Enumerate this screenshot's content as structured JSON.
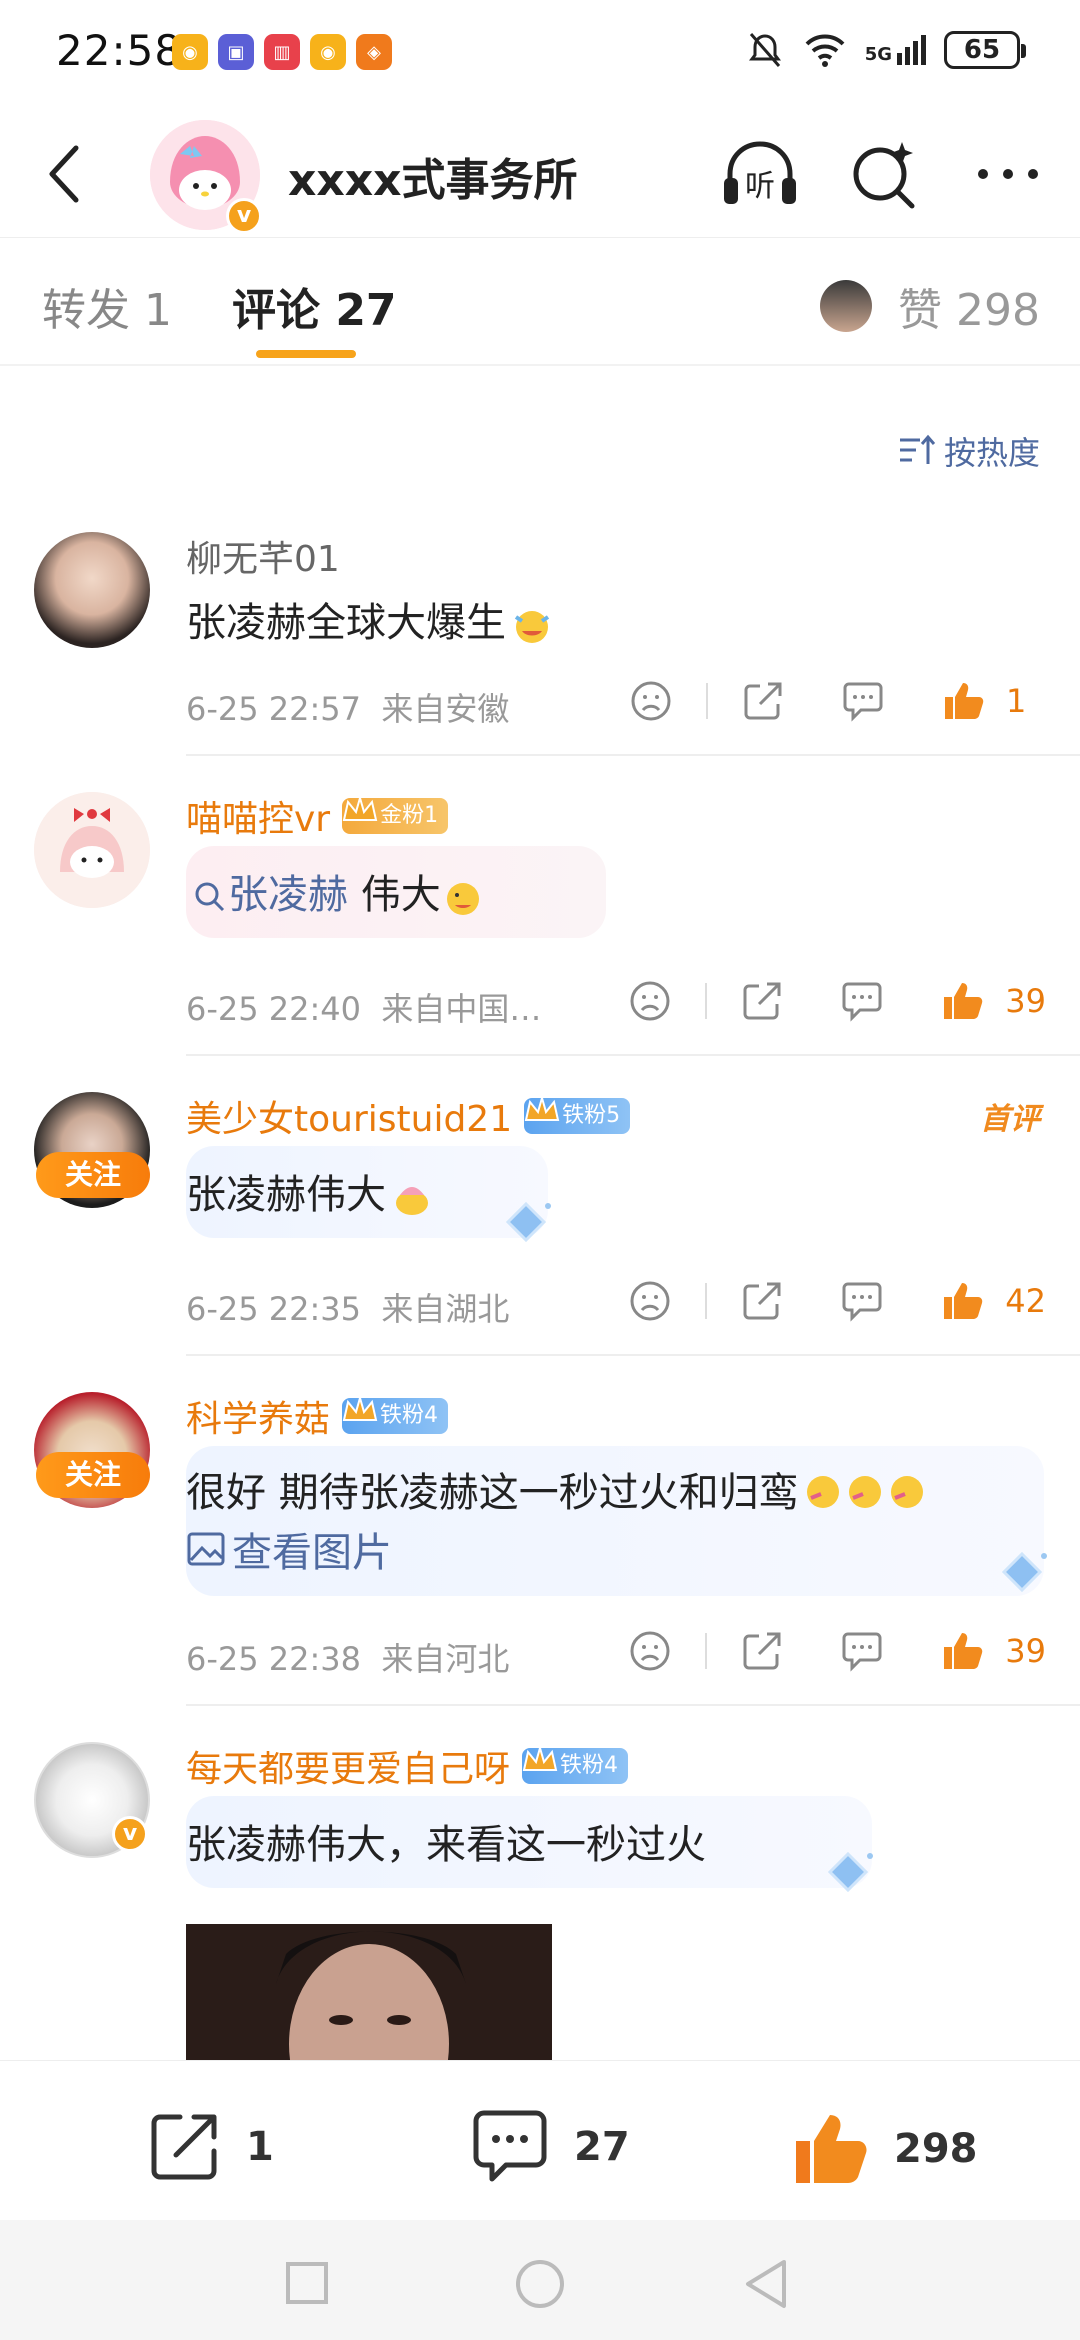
{
  "status_bar": {
    "time": "22:58",
    "battery": "65",
    "network": "5G",
    "app_icons": [
      "weibo-icon",
      "bilibili-icon",
      "reader-icon",
      "weibo-icon",
      "taobao-icon"
    ]
  },
  "header": {
    "title": "xxxx式事务所",
    "verified": "v",
    "listen_label": "听",
    "icons": [
      "back-icon",
      "headphone-icon",
      "search-sparkle-icon",
      "more-icon"
    ]
  },
  "tabs": {
    "repost": "转发 1",
    "comments": "评论 27",
    "likes": "赞 298"
  },
  "sort_label": "按热度",
  "comments": [
    {
      "username": "柳无芊01",
      "text": "张凌赫全球大爆生",
      "time": "6-25 22:57",
      "location": "来自安徽",
      "likes": "1",
      "name_color": "#666666"
    },
    {
      "username": "喵喵控vr",
      "badge": "金粉1",
      "search_term": "张凌赫",
      "text": "伟大",
      "time": "6-25 22:40",
      "location": "来自中国…",
      "likes": "39"
    },
    {
      "username": "美少女touristuid21",
      "badge": "铁粉5",
      "follow": "关注",
      "tag": "首评",
      "text": "张凌赫伟大",
      "time": "6-25 22:35",
      "location": "来自湖北",
      "likes": "42"
    },
    {
      "username": "科学养菇",
      "badge": "铁粉4",
      "follow": "关注",
      "text": "很好 期待张凌赫这一秒过火和归鸾",
      "image_link": "查看图片",
      "time": "6-25 22:38",
      "location": "来自河北",
      "likes": "39"
    },
    {
      "username": "每天都要更爱自己呀",
      "badge": "铁粉4",
      "verified": "v",
      "text": "张凌赫伟大，来看这一秒过火"
    }
  ],
  "bottom_bar": {
    "repost_count": "1",
    "comment_count": "27",
    "like_count": "298"
  },
  "colors": {
    "accent_orange": "#e87a0c",
    "link_blue": "#4f6aa0",
    "tab_underline": "#f7a31a"
  }
}
